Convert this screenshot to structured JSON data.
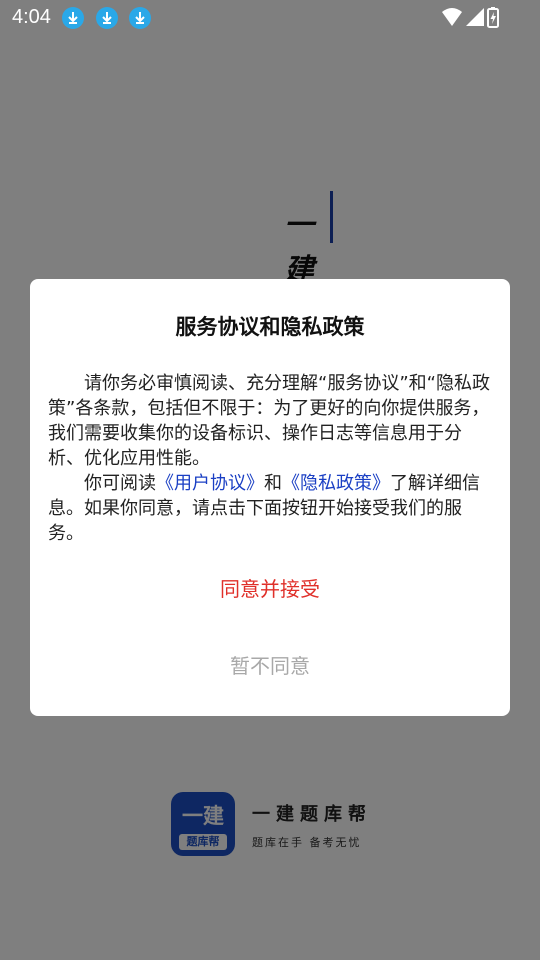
{
  "status_bar": {
    "time": "4:04",
    "notification_icons": [
      "download-icon",
      "download-icon",
      "download-icon"
    ],
    "system_icons": [
      "wifi-icon",
      "cell-signal-icon",
      "battery-charging-icon"
    ]
  },
  "splash": {
    "chars": [
      "一",
      "建"
    ],
    "app_name": "一建题库帮",
    "slogan": "题库在手  备考无忧",
    "logo_top": "一建",
    "logo_bottom": "题库帮"
  },
  "dialog": {
    "title": "服务协议和隐私政策",
    "paragraph1": "请你务必审慎阅读、充分理解“服务协议”和“隐私政策”各条款，包括但不限于：为了更好的向你提供服务，我们需要收集你的设备标识、操作日志等信息用于分析、优化应用性能。",
    "paragraph2_prefix": "你可阅读",
    "user_agreement_link": "《用户协议》",
    "paragraph2_and": "和",
    "privacy_policy_link": "《隐私政策》",
    "paragraph2_suffix": "了解详细信息。如果你同意，请点击下面按钮开始接受我们的服务。",
    "agree_label": "同意并接受",
    "decline_label": "暂不同意"
  },
  "colors": {
    "accent_red": "#e0302a",
    "link_blue": "#1a3fc4",
    "brand_blue": "#1d4fc4",
    "download_badge": "#2aa8e8"
  }
}
